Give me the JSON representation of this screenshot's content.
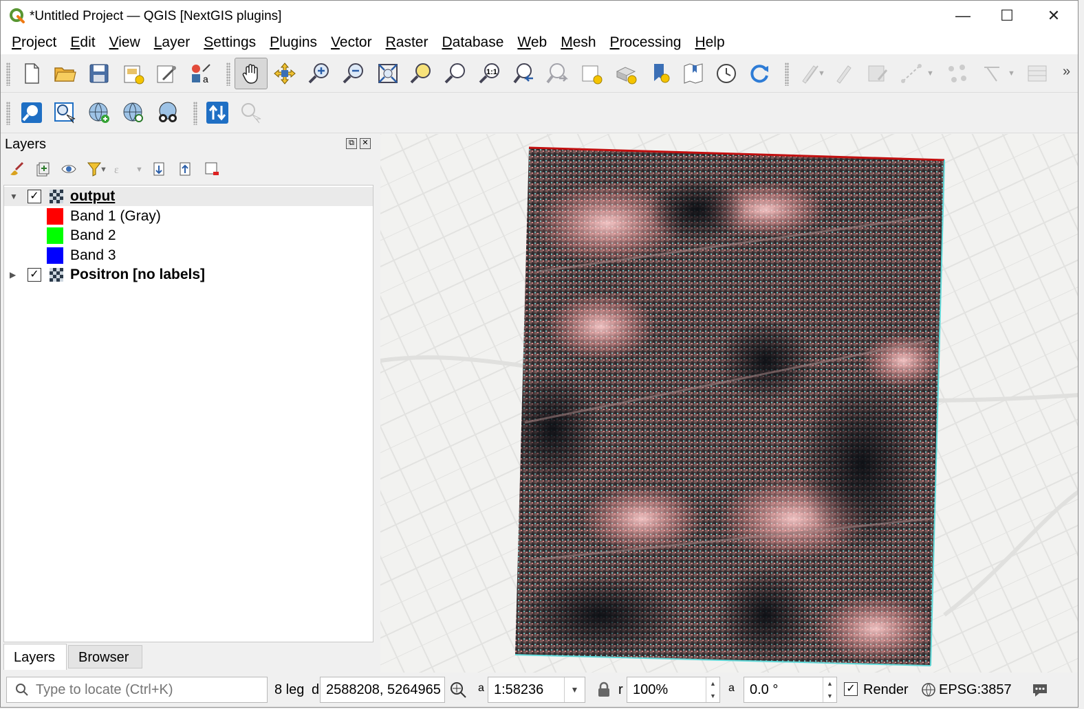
{
  "window": {
    "title": "*Untitled Project — QGIS [NextGIS plugins]",
    "minimize": "—",
    "maximize": "☐",
    "close": "✕"
  },
  "menu": [
    "Project",
    "Edit",
    "View",
    "Layer",
    "Settings",
    "Plugins",
    "Vector",
    "Raster",
    "Database",
    "Web",
    "Mesh",
    "Processing",
    "Help"
  ],
  "toolbar": {
    "overflow": "»"
  },
  "layers_panel": {
    "title": "Layers",
    "float_btn": "⧉",
    "close_btn": "✕",
    "layers": [
      {
        "name": "output",
        "checked": "✓",
        "expander": "▼",
        "bands": [
          {
            "label": "Band 1 (Gray)",
            "color": "#ff0000"
          },
          {
            "label": "Band 2",
            "color": "#00ff00"
          },
          {
            "label": "Band 3",
            "color": "#0000ff"
          }
        ]
      },
      {
        "name": "Positron [no labels]",
        "checked": "✓",
        "expander": "▶"
      }
    ],
    "tabs": {
      "layers": "Layers",
      "browser": "Browser"
    }
  },
  "statusbar": {
    "locator_placeholder": "Type to locate (Ctrl+K)",
    "legend_text": "8 leg",
    "coord_label": "d",
    "coordinate": "2588208, 5264965",
    "scale_label": "a",
    "scale": "1:58236",
    "magnifier_label": "r",
    "magnifier": "100%",
    "rotation_label": "a",
    "rotation": "0.0 °",
    "render_checked": "✓",
    "render_label": "Render",
    "crs": "EPSG:3857"
  }
}
